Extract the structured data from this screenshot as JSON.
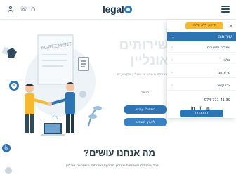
{
  "header": {
    "logo_text": "legal",
    "menu_icon": "hamburger-icon",
    "user_icon": "user-icon",
    "phone_icon": "phone-icon",
    "cart_icon": "cart-icon"
  },
  "hero": {
    "title_line1": "שירותים",
    "title_line2": "אונליין",
    "subtitle": "שירותים משפטיים אונליין מקצועיים",
    "small_link": "חשוב",
    "cta_primary": "התחילו עכשיו",
    "cta_secondary": "לייעוץ משפטי"
  },
  "illustration": {
    "document_label": "AGREEMENT"
  },
  "section": {
    "title": "מה אנחנו עושים?",
    "text": "לגל שירותים משפטיים אונליין מבצעת שירותים משפטיים אונליין"
  },
  "menu": {
    "consult_button": "לייעוץ ללא עלות",
    "close_icon": "close-icon",
    "services_label": "שירותים",
    "items": [
      "שאלות ותשובות",
      "בלוג",
      "מי אנחנו",
      "צרו קשר"
    ],
    "phone": "074-771-41-39",
    "login_button": "התחברות",
    "social": [
      "in",
      "f",
      "ig"
    ]
  },
  "colors": {
    "brand_blue": "#2e74b5",
    "accent_yellow": "#f5b82e",
    "dark_text": "#233845"
  }
}
